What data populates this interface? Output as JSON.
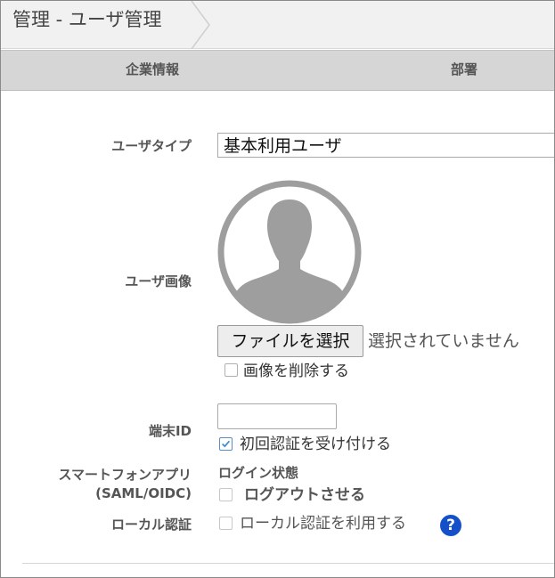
{
  "breadcrumb": {
    "text": "管理 - ユーザ管理"
  },
  "tabs": [
    {
      "label": "企業情報"
    },
    {
      "label": "部署"
    }
  ],
  "form": {
    "user_type": {
      "label": "ユーザタイプ",
      "value": "基本利用ユーザ"
    },
    "user_image": {
      "label": "ユーザ画像",
      "file_button": "ファイルを選択",
      "file_status": "選択されていません",
      "delete_label": "画像を削除する",
      "delete_checked": false
    },
    "terminal_id": {
      "label": "端末ID",
      "value": "",
      "accept_first_label": "初回認証を受け付ける",
      "accept_first_checked": true
    },
    "smartphone_app": {
      "label_line1": "スマートフォンアプリ",
      "label_line2": "(SAML/OIDC)",
      "login_state": "ログイン状態",
      "logout_label": "ログアウトさせる",
      "logout_checked": false
    },
    "local_auth": {
      "label": "ローカル認証",
      "use_label": "ローカル認証を利用する",
      "use_checked": false,
      "help_icon": "question-circle-icon"
    }
  },
  "colors": {
    "help_icon": "#1450c8",
    "checkbox_accent": "#3a8fd0",
    "avatar_gray": "#9e9e9e"
  }
}
